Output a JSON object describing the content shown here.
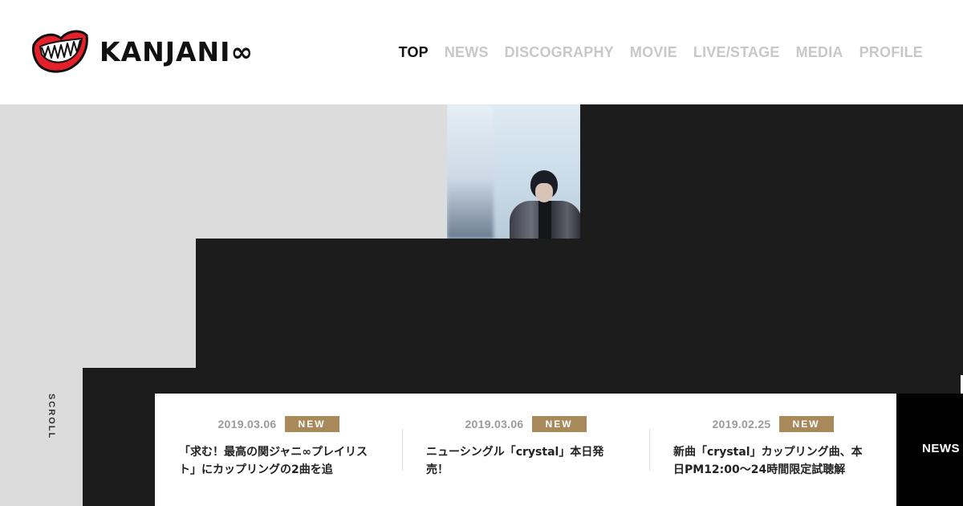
{
  "brand": {
    "name": "KANJANI∞",
    "logo_icon": "fanged-mouth-logo",
    "accent": "#e4202b"
  },
  "nav": {
    "items": [
      {
        "label": "TOP",
        "active": true
      },
      {
        "label": "NEWS",
        "active": false
      },
      {
        "label": "DISCOGRAPHY",
        "active": false
      },
      {
        "label": "MOVIE",
        "active": false
      },
      {
        "label": "LIVE/STAGE",
        "active": false
      },
      {
        "label": "MEDIA",
        "active": false
      },
      {
        "label": "PROFILE",
        "active": false
      }
    ],
    "active_color": "#111111",
    "inactive_color": "#c8c8c8"
  },
  "hero": {
    "scroll_label": "SCROLL",
    "background": "#dcdcdc",
    "panel_color": "#1c1c1c"
  },
  "news": {
    "badge_color": "#a8895a",
    "items": [
      {
        "date": "2019.03.06",
        "badge": "NEW",
        "title": "「求む！最高の関ジャニ∞プレイリスト」にカップリングの2曲を追"
      },
      {
        "date": "2019.03.06",
        "badge": "NEW",
        "title": "ニューシングル「crystal」本日発売！"
      },
      {
        "date": "2019.02.25",
        "badge": "NEW",
        "title": "新曲「crystal」カップリング曲、本日PM12:00～24時間限定試聴解"
      }
    ],
    "all_label": "NEWS ALL"
  }
}
